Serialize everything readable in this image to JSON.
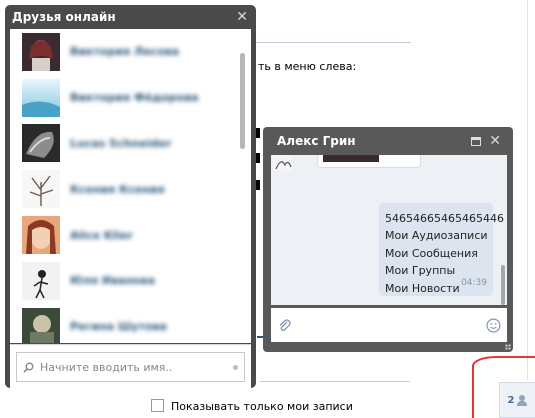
{
  "background": {
    "menu_hint": "ть в меню слева:",
    "show_only_mine": "Показывать только мои записи"
  },
  "friends_online": {
    "title": "Друзья онлайн",
    "friends": [
      {
        "name": "Виктория Лесова"
      },
      {
        "name": "Виктория Фёдорова"
      },
      {
        "name": "Lucas Schneider"
      },
      {
        "name": "Ксения Ксения"
      },
      {
        "name": "Alice Klier"
      },
      {
        "name": "Юля Иванова"
      },
      {
        "name": "Регина Шутова"
      }
    ],
    "search_placeholder": "Начните вводить имя.."
  },
  "chat": {
    "title": "Алекс Грин",
    "message_lines": [
      "54654665465465446",
      "Мои Аудиозаписи",
      "Мои Сообщения",
      "Мои Группы",
      "Мои Новости"
    ],
    "message_time": "04:39"
  },
  "counter": {
    "value": "2"
  },
  "colors": {
    "window_header": "#4a4a4a",
    "link": "#2b587a",
    "bubble": "#dce4ef"
  }
}
